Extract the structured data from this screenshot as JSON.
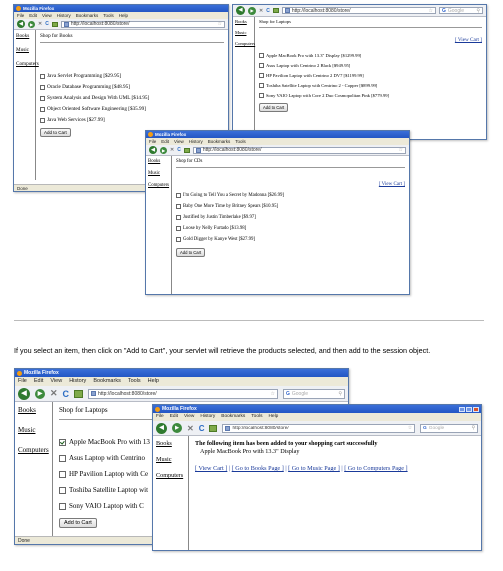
{
  "browser": {
    "title": "Mozilla Firefox",
    "menu": [
      "File",
      "Edit",
      "View",
      "History",
      "Bookmarks",
      "Tools",
      "Help"
    ],
    "search_placeholder": "Google",
    "status": "Done",
    "icons": {
      "back": "back-arrow-icon",
      "forward": "forward-arrow-icon",
      "stop": "stop-icon",
      "reload": "reload-icon",
      "home": "home-icon",
      "star": "bookmark-star-icon",
      "search": "search-icon"
    }
  },
  "nav": {
    "books": "Books",
    "music": "Music",
    "computers": "Computers"
  },
  "books_window": {
    "url": "http://localhost:8080/store/",
    "heading": "Shop for Books",
    "items": [
      "Java Servlet Programming [$29.95]",
      "Oracle Database Programming [$48.95]",
      "System Analysis and Design With UML [$14.95]",
      "Object Oriented Software Engineering [$35.99]",
      "Java Web Services [$27.99]"
    ],
    "button": "Add to Cart"
  },
  "laptops_window_top": {
    "url": "http://localhost:8080/store/",
    "heading": "Shop for Laptops",
    "view_cart": "[ View Cart ]",
    "items": [
      "Apple MacBook Pro with 13.3\" Display [$1299.99]",
      "Asus Laptop with Centrino 2 Black [$949.95]",
      "HP Pavilion Laptop with Centrino 2 DV7 [$1199.99]",
      "Toshiba Satellite Laptop with Centrino 2 - Copper [$899.99]",
      "Sony VAIO Laptop with Core 2 Duo Cosmopolitan Pink [$779.99]"
    ],
    "button": "Add to Cart"
  },
  "music_window": {
    "url": "http://localhost:8080/store/",
    "heading": "Shop for CDs",
    "view_cart": "[ View Cart ]",
    "items": [
      "I'm Going to Tell You a Secret by Madonna [$26.99]",
      "Baby One More Time by Britney Spears [$10.95]",
      "Justified by Justin Timberlake [$9.97]",
      "Loose by Nelly Furtado [$13.98]",
      "Gold Digger by Kanye West [$27.99]"
    ],
    "button": "Add to Cart"
  },
  "caption": "If you select an item, then click on \"Add to Cart\", your servlet will retrieve the products selected, and then add to the session object.",
  "laptops_window_bottom": {
    "url": "http://localhost:8080/store/",
    "heading": "Shop for Laptops",
    "items": [
      "Apple MacBook Pro with 13",
      "Asus Laptop with Centrino",
      "HP Pavilion Laptop with Ce",
      "Toshiba Satellite Laptop wit",
      "Sony VAIO Laptop with C"
    ],
    "checked_index": 0,
    "button": "Add to Cart"
  },
  "confirm_window": {
    "url": "http://localhost:8080/store/",
    "message": "The following item has been added to your shopping cart successfully",
    "item": "Apple MacBook Pro with 13.3\" Display",
    "links": [
      "[ View Cart ]",
      "[ Go to Books Page ]",
      "[ Go to Music Page ]",
      "[ Go to Computers Page ]"
    ]
  }
}
